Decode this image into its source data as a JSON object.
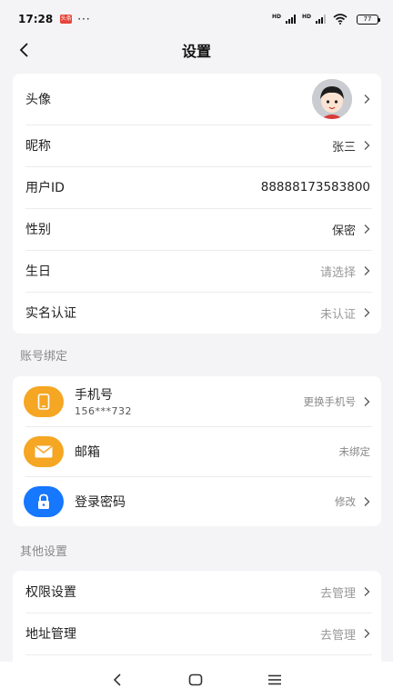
{
  "status_bar": {
    "time": "17:28",
    "badge_label": "头条",
    "dots": "···",
    "battery": "77"
  },
  "header": {
    "title": "设置"
  },
  "profile": [
    {
      "label": "头像",
      "value": "",
      "has_chevron": true
    },
    {
      "label": "昵称",
      "value": "张三",
      "has_chevron": true
    },
    {
      "label": "用户ID",
      "value": "88888173583800",
      "has_chevron": false
    },
    {
      "label": "性别",
      "value": "保密",
      "has_chevron": true
    },
    {
      "label": "生日",
      "value": "请选择",
      "has_chevron": true
    },
    {
      "label": "实名认证",
      "value": "未认证",
      "has_chevron": true
    }
  ],
  "account_binding": {
    "title": "账号绑定",
    "items": [
      {
        "label": "手机号",
        "sub": "156***732",
        "value": "更换手机号",
        "icon": "phone-icon",
        "color": "#f5a623"
      },
      {
        "label": "邮箱",
        "sub": "",
        "value": "未绑定",
        "icon": "mail-icon",
        "color": "#f5a623"
      },
      {
        "label": "登录密码",
        "sub": "",
        "value": "修改",
        "icon": "lock-icon",
        "color": "#1677ff"
      }
    ]
  },
  "other_settings": {
    "title": "其他设置",
    "items": [
      {
        "label": "权限设置",
        "value": "去管理"
      },
      {
        "label": "地址管理",
        "value": "去管理"
      }
    ]
  }
}
